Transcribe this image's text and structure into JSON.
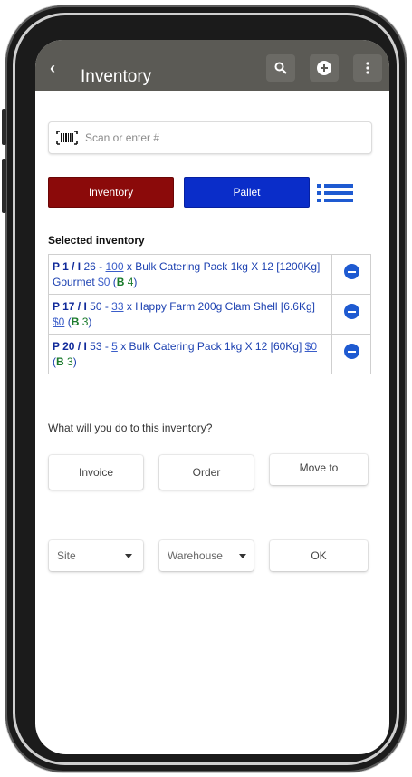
{
  "app": {
    "title": "Inventory"
  },
  "appbar": {
    "icons": [
      "chevron-left-icon",
      "search-icon",
      "add-circle-icon",
      "more-vertical-icon"
    ]
  },
  "search": {
    "placeholder": "Scan or enter #",
    "value": ""
  },
  "toggle": {
    "inventory_label": "Inventory",
    "pallet_label": "Pallet",
    "inventory_color": "#8b0a0a",
    "pallet_color": "#0a2dc9"
  },
  "selected": {
    "heading": "Selected inventory",
    "items": [
      {
        "p": "P 1 / I",
        "rest": " 26 - ",
        "qty": "100",
        "desc": " x Bulk Catering Pack 1kg X 12 [1200Kg] Gourmet ",
        "price": "$0",
        "open": " (",
        "b": "B",
        "bnum": " 4",
        "close": ")"
      },
      {
        "p": "P 17 / I",
        "rest": " 50 - ",
        "qty": "33",
        "desc": " x Happy Farm 200g Clam Shell [6.6Kg] ",
        "price": "$0",
        "open": " (",
        "b": "B",
        "bnum": " 3",
        "close": ")"
      },
      {
        "p": "P 20 / I",
        "rest": " 53 - ",
        "qty": "5",
        "desc": " x Bulk Catering Pack 1kg X 12 [60Kg] ",
        "price": "$0",
        "open": " (",
        "b": "B",
        "bnum": " 3",
        "close": ")"
      }
    ]
  },
  "actions": {
    "question": "What will you do to this inventory?",
    "invoice_label": "Invoice",
    "order_label": "Order",
    "move_label": "Move to"
  },
  "selects": {
    "site_label": "Site",
    "warehouse_label": "Warehouse",
    "ok_label": "OK"
  }
}
